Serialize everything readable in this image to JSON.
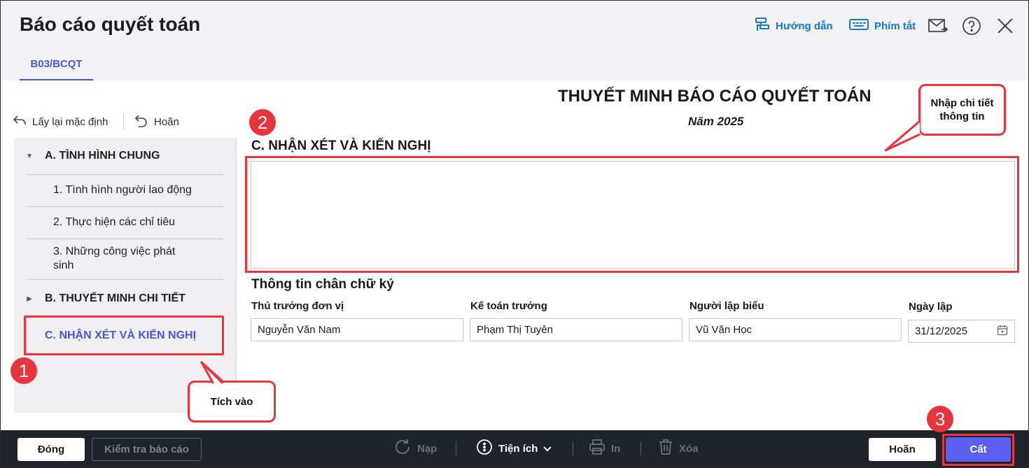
{
  "window": {
    "title": "Báo cáo quyết toán",
    "tab": "B03/BCQT",
    "actions": {
      "guide": "Hướng dẫn",
      "shortcuts": "Phím tắt"
    }
  },
  "sidebar": {
    "reset_default": "Lấy lại mặc định",
    "undo": "Hoãn",
    "groups": [
      {
        "label": "A. TÌNH HÌNH CHUNG",
        "expanded": true,
        "items": [
          "1. Tình hình người lao động",
          "2. Thực hiện các chỉ tiêu",
          "3. Những công việc phát sinh"
        ]
      },
      {
        "label": "B. THUYẾT MINH CHI TIẾT",
        "expanded": false
      },
      {
        "label": "C. NHẬN XÉT VÀ KIẾN NGHỊ",
        "selected": true
      }
    ]
  },
  "document": {
    "title": "THUYẾT MINH BÁO CÁO QUYẾT TOÁN",
    "year": "Năm 2025",
    "section_title": "C. NHẬN XÉT VÀ KIẾN NGHỊ",
    "comment_value": "",
    "signature": {
      "title": "Thông tin chân chữ ký",
      "fields": [
        {
          "label": "Thủ trưởng đơn vị",
          "value": "Nguyễn Văn Nam"
        },
        {
          "label": "Kế toán trưởng",
          "value": "Phạm Thị Tuyên"
        },
        {
          "label": "Người lập biểu",
          "value": "Vũ Văn Học"
        },
        {
          "label": "Ngày lập",
          "value": "31/12/2025"
        }
      ]
    }
  },
  "annotations": {
    "step1": "1",
    "step2": "2",
    "step3": "3",
    "callout_click": "Tích vào",
    "callout_enter_line1": "Nhập chi tiết",
    "callout_enter_line2": "thông tin"
  },
  "footer": {
    "close": "Đóng",
    "check_report": "Kiểm tra báo cáo",
    "load": "Nạp",
    "utilities": "Tiện ích",
    "print": "In",
    "delete": "Xóa",
    "undo": "Hoãn",
    "save": "Cất"
  },
  "colors": {
    "accent": "#4a57d6",
    "link": "#1877c9",
    "annotation_red": "#e8343d",
    "footer_bg": "#1f232b",
    "save_button": "#5b5ff0"
  }
}
